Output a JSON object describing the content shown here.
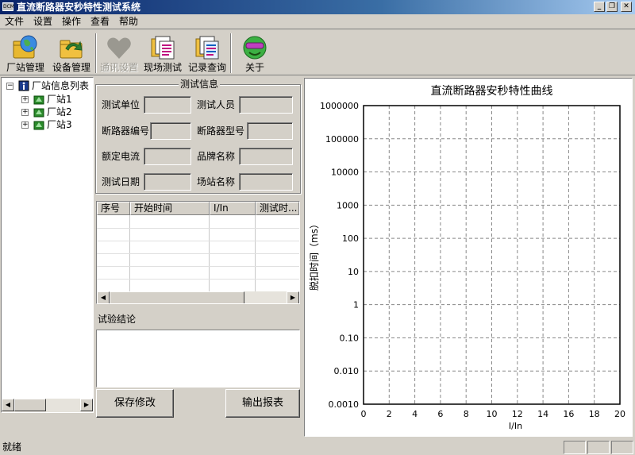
{
  "window": {
    "title": "直流断路器安秒特性测试系统",
    "icon_text": "DCM",
    "controls": [
      "_",
      "❐",
      "✕"
    ]
  },
  "menu": [
    "文件",
    "设置",
    "操作",
    "查看",
    "帮助"
  ],
  "toolbar": {
    "buttons": [
      {
        "label": "厂站管理",
        "icon": "globe-folder-icon",
        "enabled": true
      },
      {
        "label": "设备管理",
        "icon": "folder-arrow-icon",
        "enabled": true
      },
      {
        "label": "通讯设置",
        "icon": "heart-icon",
        "enabled": false
      },
      {
        "label": "现场测试",
        "icon": "documents-icon",
        "enabled": true
      },
      {
        "label": "记录查询",
        "icon": "documents-search-icon",
        "enabled": true
      },
      {
        "label": "关于",
        "icon": "smiley-sunglasses-icon",
        "enabled": true
      }
    ]
  },
  "tree": {
    "root": "厂站信息列表",
    "children": [
      "厂站1",
      "厂站2",
      "厂站3"
    ]
  },
  "test_info": {
    "title": "测试信息",
    "fields": {
      "unit": {
        "label": "测试单位",
        "value": ""
      },
      "tester": {
        "label": "测试人员",
        "value": ""
      },
      "breaker_no": {
        "label": "断路器编号",
        "value": ""
      },
      "breaker_model": {
        "label": "断路器型号",
        "value": ""
      },
      "rated_current": {
        "label": "额定电流",
        "value": ""
      },
      "brand": {
        "label": "品牌名称",
        "value": ""
      },
      "test_date": {
        "label": "测试日期",
        "value": ""
      },
      "station": {
        "label": "场站名称",
        "value": ""
      }
    }
  },
  "table": {
    "columns": [
      "序号",
      "开始时间",
      "I/In",
      "测试时..."
    ],
    "rows": []
  },
  "conclusion": {
    "label": "试验结论",
    "value": ""
  },
  "buttons": {
    "save": "保存修改",
    "export": "输出报表"
  },
  "chart_data": {
    "type": "line",
    "title": "直流断路器安秒特性曲线",
    "xlabel": "I/In",
    "ylabel": "脱扣时间（ms）",
    "xlim": [
      0,
      20
    ],
    "x_ticks": [
      "0",
      "2",
      "4",
      "6",
      "8",
      "10",
      "12",
      "14",
      "16",
      "18",
      "20"
    ],
    "yscale": "log",
    "ylim": [
      0.001,
      1000000
    ],
    "y_ticks": [
      "1000000",
      "100000",
      "10000",
      "1000",
      "100",
      "10",
      "1",
      "0.10",
      "0.010",
      "0.0010"
    ],
    "grid": true,
    "series": []
  },
  "status": {
    "text": "就绪"
  }
}
